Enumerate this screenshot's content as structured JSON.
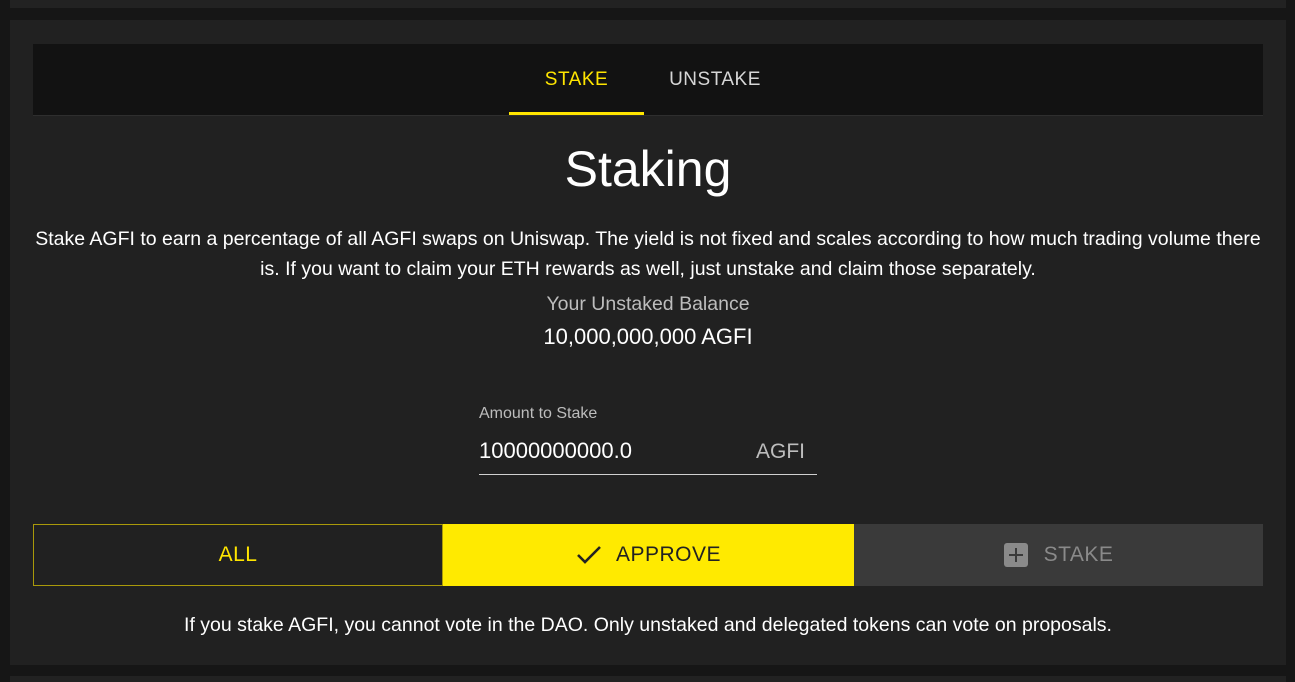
{
  "tabs": {
    "stake": "STAKE",
    "unstake": "UNSTAKE",
    "active": "stake"
  },
  "title": "Staking",
  "description": "Stake AGFI to earn a percentage of all AGFI swaps on Uniswap. The yield is not fixed and scales according to how much trading volume there is. If you want to claim your ETH rewards as well, just unstake and claim those separately.",
  "balance": {
    "label": "Your Unstaked Balance",
    "value": "10,000,000,000 AGFI"
  },
  "amount": {
    "label": "Amount to Stake",
    "value": "10000000000.0",
    "unit": "AGFI"
  },
  "buttons": {
    "all": "ALL",
    "approve": "APPROVE",
    "stake": "STAKE"
  },
  "footer_note": "If you stake AGFI, you cannot vote in the DAO. Only unstaked and delegated tokens can vote on proposals.",
  "colors": {
    "accent": "#ffe500",
    "background": "#161616",
    "card": "#212121",
    "tabbar": "#121212",
    "disabled_button": "#3a3a3a"
  },
  "icons": {
    "approve": "check-icon",
    "stake": "plus-box-icon"
  }
}
